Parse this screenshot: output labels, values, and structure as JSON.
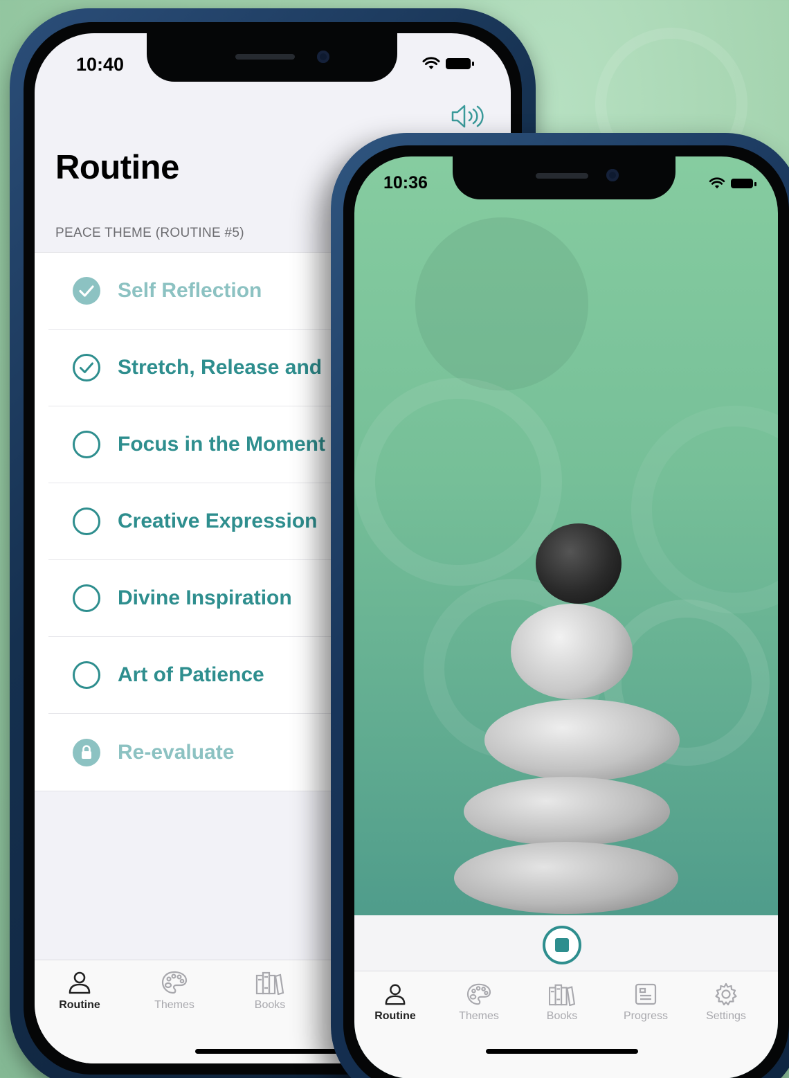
{
  "back_phone": {
    "status_time": "10:40",
    "title": "Routine",
    "section_header": "PEACE THEME (ROUTINE #5)",
    "items": [
      {
        "label": "Self Reflection",
        "state": "completed-filled"
      },
      {
        "label": "Stretch, Release and",
        "state": "completed"
      },
      {
        "label": "Focus in the Moment",
        "state": "pending"
      },
      {
        "label": "Creative Expression",
        "state": "pending"
      },
      {
        "label": "Divine Inspiration",
        "state": "pending"
      },
      {
        "label": "Art of Patience",
        "state": "pending"
      },
      {
        "label": "Re-evaluate",
        "state": "locked"
      }
    ],
    "tabs": [
      {
        "label": "Routine",
        "icon": "person-icon",
        "active": true
      },
      {
        "label": "Themes",
        "icon": "palette-icon",
        "active": false
      },
      {
        "label": "Books",
        "icon": "books-icon",
        "active": false
      }
    ]
  },
  "front_phone": {
    "status_time": "10:36",
    "tabs": [
      {
        "label": "Routine",
        "icon": "person-icon",
        "active": true
      },
      {
        "label": "Themes",
        "icon": "palette-icon",
        "active": false
      },
      {
        "label": "Books",
        "icon": "books-icon",
        "active": false
      },
      {
        "label": "Progress",
        "icon": "progress-icon",
        "active": false
      },
      {
        "label": "Settings",
        "icon": "gear-icon",
        "active": false
      }
    ]
  },
  "colors": {
    "accent": "#2e8e8e",
    "accent_muted": "#8cc2c2",
    "background": "#a2d2ad"
  }
}
